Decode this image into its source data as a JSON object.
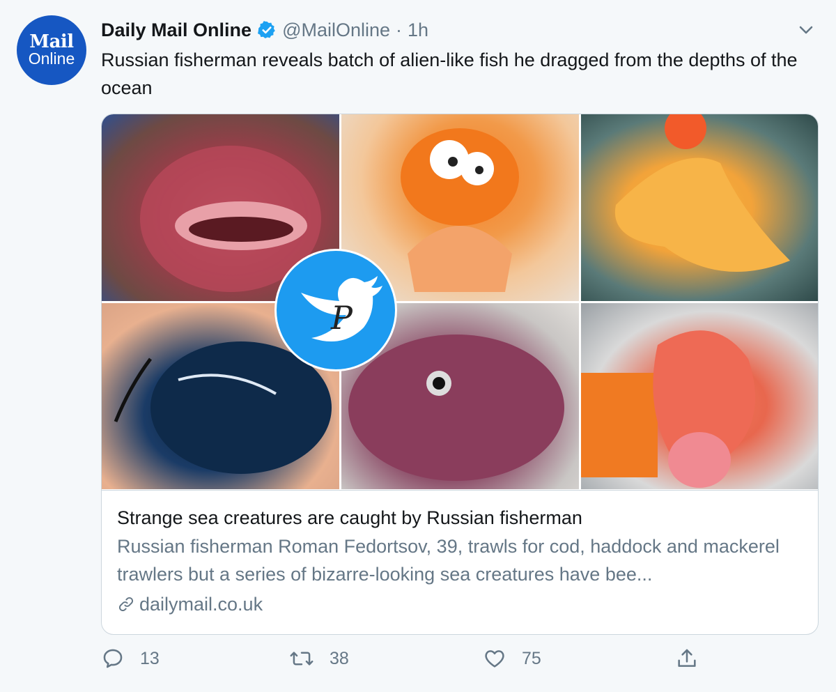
{
  "account": {
    "avatar_line1": "Mail",
    "avatar_line2": "Online",
    "display_name": "Daily Mail Online",
    "handle": "@MailOnline",
    "separator": "·",
    "time": "1h"
  },
  "tweet": {
    "text": "Russian fisherman reveals batch of alien-like fish he dragged from the depths of the ocean"
  },
  "card": {
    "title": "Strange sea creatures are caught by Russian fisherman",
    "description": "Russian fisherman Roman Fedortsov, 39, trawls for cod, haddock and mackerel trawlers but a series of bizarre-looking sea creatures have bee...",
    "link": "dailymail.co.uk"
  },
  "actions": {
    "reply_count": "13",
    "retweet_count": "38",
    "like_count": "75"
  },
  "colors": {
    "background": "#f5f8fa",
    "brand_blue": "#1657c2",
    "verified_blue": "#1da1f2",
    "secondary_text": "#657786"
  },
  "icons": {
    "verified": "verified-badge-icon",
    "menu": "chevron-down-icon",
    "link": "link-icon",
    "reply": "reply-icon",
    "retweet": "retweet-icon",
    "like": "heart-icon",
    "share": "share-icon",
    "watermark": "twitter-bird-watermark-icon"
  }
}
